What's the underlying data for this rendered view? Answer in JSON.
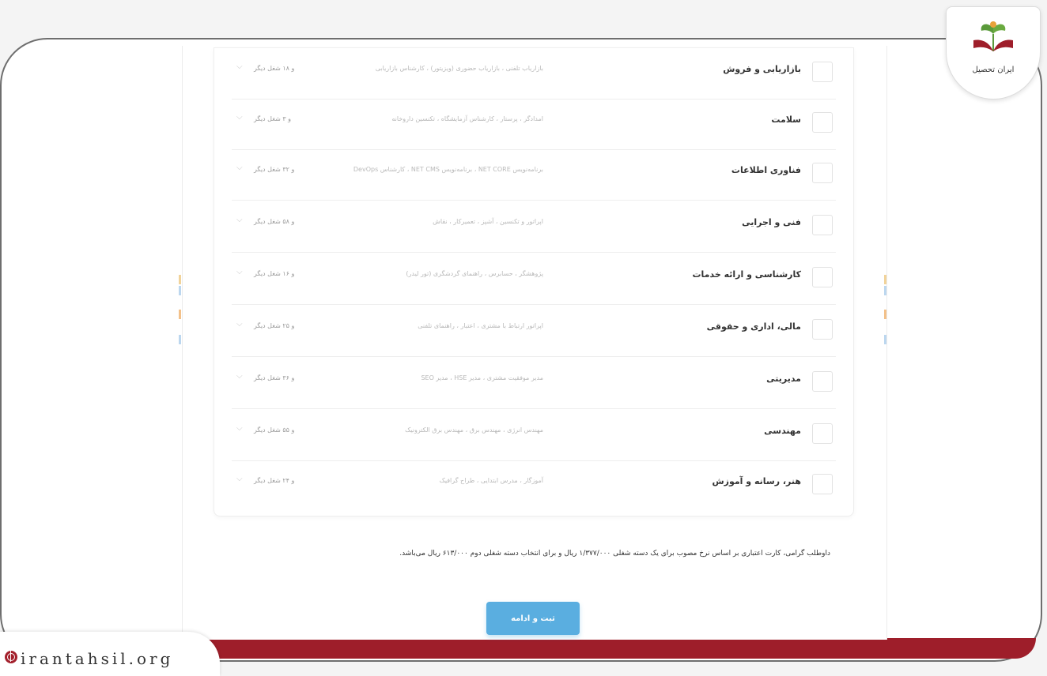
{
  "brand": {
    "name": "ایران تحصیل",
    "website": "irantahsil.org",
    "colors": {
      "accent": "#9e1e2a",
      "button": "#5aaee0",
      "logo_green": "#5a9a3a",
      "logo_orange": "#e8a23a"
    }
  },
  "categories": [
    {
      "label": "بازاریابی و فروش",
      "examples": "بازاریاب تلفنی ، بازاریاب حضوری (ویزیتور) ، کارشناس بازاریابی",
      "more": "و ۱۸ شغل دیگر"
    },
    {
      "label": "سلامت",
      "examples": "امدادگر ، پرستار ، کارشناس آزمایشگاه ، تکنسین داروخانه",
      "more": "و ۳ شغل دیگر"
    },
    {
      "label": "فناوری اطلاعات",
      "examples": "برنامه‌نویس NET CORE ، برنامه‌نویس NET CMS ، کارشناس DevOps",
      "more": "و ۳۲ شغل دیگر"
    },
    {
      "label": "فنی و اجرایی",
      "examples": "اپراتور و تکنسین ، آشپز ، تعمیرکار ، نقاش",
      "more": "و ۵۸ شغل دیگر"
    },
    {
      "label": "کارشناسی و ارائه خدمات",
      "examples": "پژوهشگر ، حسابرس ، راهنمای گردشگری (تور لیدر)",
      "more": "و ۱۶ شغل دیگر"
    },
    {
      "label": "مالی، اداری و حقوقی",
      "examples": "اپراتور ارتباط با مشتری ، اعتبار ، راهنمای تلفنی",
      "more": "و ۲۵ شغل دیگر"
    },
    {
      "label": "مدیریتی",
      "examples": "مدیر موفقیت مشتری ، مدیر HSE ، مدیر SEO",
      "more": "و ۳۶ شغل دیگر"
    },
    {
      "label": "مهندسی",
      "examples": "مهندس انرژی ، مهندس برق ، مهندس برق الکترونیک",
      "more": "و ۵۵ شغل دیگر"
    },
    {
      "label": "هنر، رسانه و آموزش",
      "examples": "آموزگار ، مدرس ابتدایی ، طراح گرافیک",
      "more": "و ۲۴ شغل دیگر"
    }
  ],
  "notice": "داوطلب گرامی، کارت اعتباری بر اساس نرخ مصوب برای یک دسته شغلی ۱/۳۷۷/۰۰۰ ریال و برای انتخاب دسته شغلی دوم ۶۱۳/۰۰۰ ریال می‌باشد.",
  "submit_label": "ثبت و ادامه"
}
